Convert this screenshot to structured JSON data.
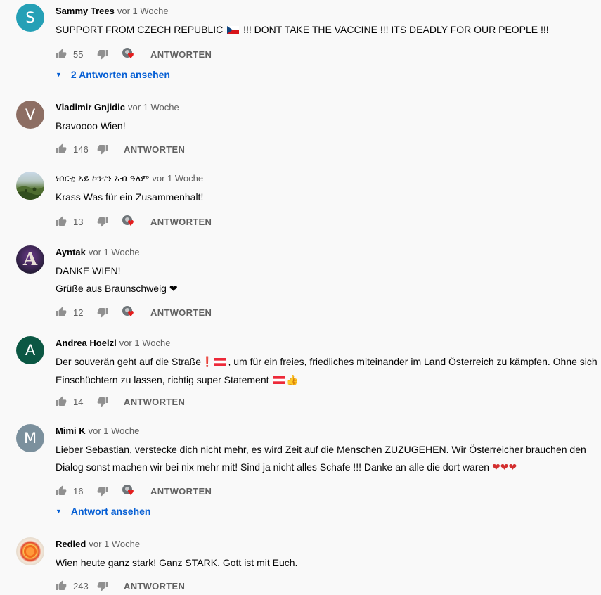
{
  "comments": [
    {
      "author": "Sammy Trees",
      "time": "vor 1 Woche",
      "avatar_letter": "S",
      "avatar_color": "#25a0b6",
      "text_a": "SUPPORT FROM CZECH REPUBLIC ",
      "text_b": " !!! DONT TAKE THE VACCINE !!! ITS DEADLY FOR OUR PEOPLE !!!",
      "likes": "55",
      "reply_label": "ANTWORTEN",
      "view_replies": "2 Antworten ansehen"
    },
    {
      "author": "Vladimir Gnjidic",
      "time": "vor 1 Woche",
      "avatar_letter": "V",
      "avatar_color": "#8d6e63",
      "text": "Bravoooo Wien!",
      "likes": "146",
      "reply_label": "ANTWORTEN"
    },
    {
      "author": "ነበርቲ ኣይ ኮንናን ኣብ ዓለም",
      "time": "vor 1 Woche",
      "text": "Krass Was für ein Zusammenhalt!",
      "likes": "13",
      "reply_label": "ANTWORTEN"
    },
    {
      "author": "Ayntak",
      "time": "vor 1 Woche",
      "avatar_letter": "A",
      "text_line1": "DANKE WIEN!",
      "text_line2": "Grüße aus Braunschweig ",
      "text_heart": "❤",
      "likes": "12",
      "reply_label": "ANTWORTEN"
    },
    {
      "author": "Andrea Hoelzl",
      "time": "vor 1 Woche",
      "avatar_letter": "A",
      "avatar_color": "#0b5743",
      "text_a": "Der souverän geht auf die Straße",
      "text_excl": "❗",
      "text_b": ", um für ein freies, friedliches miteinander im Land Österreich zu kämpfen. Ohne sich",
      "text_c": "Einschüchtern zu lassen, richtig super Statement ",
      "text_thumb": "👍",
      "likes": "14",
      "reply_label": "ANTWORTEN"
    },
    {
      "author": "Mimi K",
      "time": "vor 1 Woche",
      "avatar_letter": "M",
      "avatar_color": "#7b909d",
      "text_line1": "Lieber Sebastian, verstecke dich nicht mehr, es wird Zeit auf die Menschen ZUZUGEHEN. Wir Österreicher brauchen den",
      "text_line2": "Dialog sonst machen wir bei nix mehr mit! Sind ja nicht alles Schafe !!! Danke an alle die dort waren ",
      "text_hearts": "❤❤❤",
      "likes": "16",
      "reply_label": "ANTWORTEN",
      "view_replies": "Antwort ansehen"
    },
    {
      "author": "Redled",
      "time": "vor 1 Woche",
      "text": "Wien heute ganz stark! Ganz STARK. Gott ist mit Euch.",
      "likes": "243",
      "reply_label": "ANTWORTEN"
    }
  ]
}
